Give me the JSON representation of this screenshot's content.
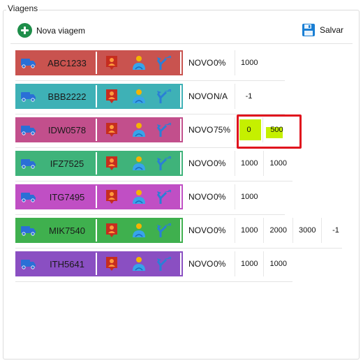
{
  "group": {
    "title": "Viagens"
  },
  "toolbar": {
    "new_label": "Nova viagem",
    "save_label": "Salvar",
    "new_icon": "add-circle-icon",
    "save_icon": "floppy-disk-icon",
    "colors": {
      "add": "#1e8e4a",
      "save": "#1a7fd4"
    }
  },
  "trips": [
    {
      "plate": "ABC1233",
      "color": "#c9534f",
      "status": "NOVO",
      "progress": "0%",
      "values": [
        "1000"
      ]
    },
    {
      "plate": "BBB2222",
      "color": "#3eb1b6",
      "status": "NOVO",
      "progress": "N/A",
      "values": [
        "-1"
      ]
    },
    {
      "plate": "IDW0578",
      "color": "#c24f8c",
      "status": "NOVO",
      "progress": "75%",
      "values": [
        "0",
        "500"
      ],
      "highlight_color": "#c5f000"
    },
    {
      "plate": "IFZ7525",
      "color": "#3fb37a",
      "status": "NOVO",
      "progress": "0%",
      "values": [
        "1000",
        "1000"
      ]
    },
    {
      "plate": "ITG7495",
      "color": "#c04fc4",
      "status": "NOVO",
      "progress": "0%",
      "values": [
        "1000"
      ]
    },
    {
      "plate": "MIK7540",
      "color": "#3fb04e",
      "status": "NOVO",
      "progress": "0%",
      "values": [
        "1000",
        "2000",
        "3000",
        "-1"
      ]
    },
    {
      "plate": "ITH5641",
      "color": "#8a4fc2",
      "status": "NOVO",
      "progress": "0%",
      "values": [
        "1000",
        "1000"
      ]
    }
  ],
  "icons": {
    "truck": "truck-icon",
    "pin": "location-pin-icon",
    "person": "driver-person-icon",
    "route": "route-fork-icon"
  },
  "annotation": {
    "color": "#e0121d"
  }
}
